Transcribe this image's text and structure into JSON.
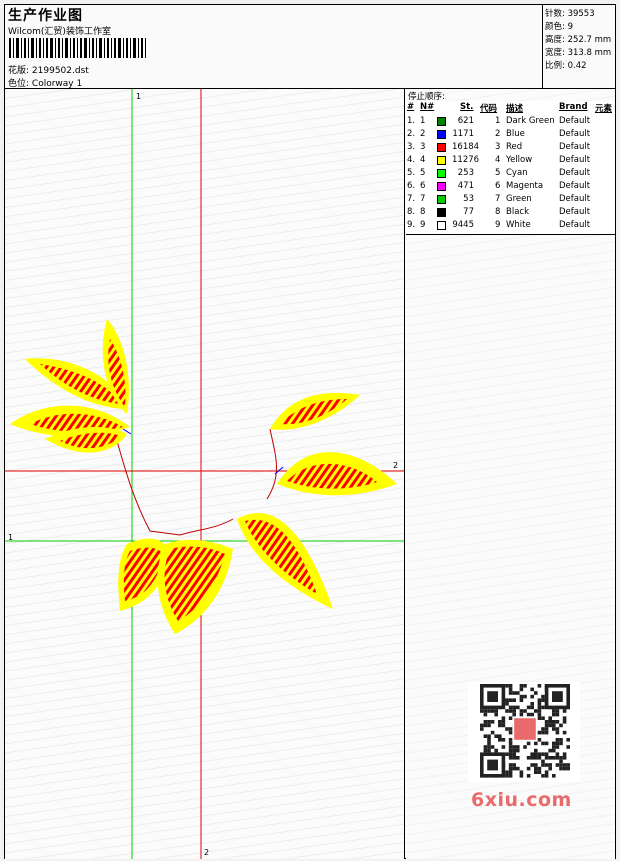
{
  "header": {
    "title": "生产作业图",
    "studio": "Wilcom(汇贸)装饰工作室",
    "design_label": "花版:",
    "design_value": "2199502.dst",
    "colorway_label": "色位:",
    "colorway_value": "Colorway 1"
  },
  "stats": {
    "stitches_label": "针数:",
    "stitches_value": "39553",
    "colors_label": "颜色:",
    "colors_value": "9",
    "height_label": "高度:",
    "height_value": "252.7 mm",
    "width_label": "宽度:",
    "width_value": "313.8 mm",
    "scale_label": "比例:",
    "scale_value": "0.42"
  },
  "guides": {
    "green_top": "1",
    "green_left": "1",
    "red_right": "2",
    "red_bottom": "2"
  },
  "side": {
    "stop_heading": "停止顺序:",
    "columns": {
      "num": "#",
      "n": "N#",
      "st": "St.",
      "code": "代码",
      "desc": "描述",
      "brand": "Brand",
      "elem": "元素"
    },
    "rows": [
      {
        "num": "1.",
        "n": "1",
        "color": "#008000",
        "st": "621",
        "code": "1",
        "desc": "Dark Green",
        "brand": "Default"
      },
      {
        "num": "2.",
        "n": "2",
        "color": "#0000ff",
        "st": "1171",
        "code": "2",
        "desc": "Blue",
        "brand": "Default"
      },
      {
        "num": "3.",
        "n": "3",
        "color": "#ff0000",
        "st": "16184",
        "code": "3",
        "desc": "Red",
        "brand": "Default"
      },
      {
        "num": "4.",
        "n": "4",
        "color": "#ffff00",
        "st": "11276",
        "code": "4",
        "desc": "Yellow",
        "brand": "Default"
      },
      {
        "num": "5.",
        "n": "5",
        "color": "#00ff00",
        "st": "253",
        "code": "5",
        "desc": "Cyan",
        "brand": "Default"
      },
      {
        "num": "6.",
        "n": "6",
        "color": "#ff00ff",
        "st": "471",
        "code": "6",
        "desc": "Magenta",
        "brand": "Default"
      },
      {
        "num": "7.",
        "n": "7",
        "color": "#00cc00",
        "st": "53",
        "code": "7",
        "desc": "Green",
        "brand": "Default"
      },
      {
        "num": "8.",
        "n": "8",
        "color": "#000000",
        "st": "77",
        "code": "8",
        "desc": "Black",
        "brand": "Default"
      },
      {
        "num": "9.",
        "n": "9",
        "color": "#ffffff",
        "st": "9445",
        "code": "9",
        "desc": "White",
        "brand": "Default"
      }
    ]
  },
  "watermark": {
    "site": "6xiu.com",
    "accent": "#e86a6a"
  },
  "colors": {
    "leaf_fill": "#ffff00",
    "vein": "#ff0000",
    "guide_green": "#00cc00",
    "guide_red": "#e00000"
  }
}
